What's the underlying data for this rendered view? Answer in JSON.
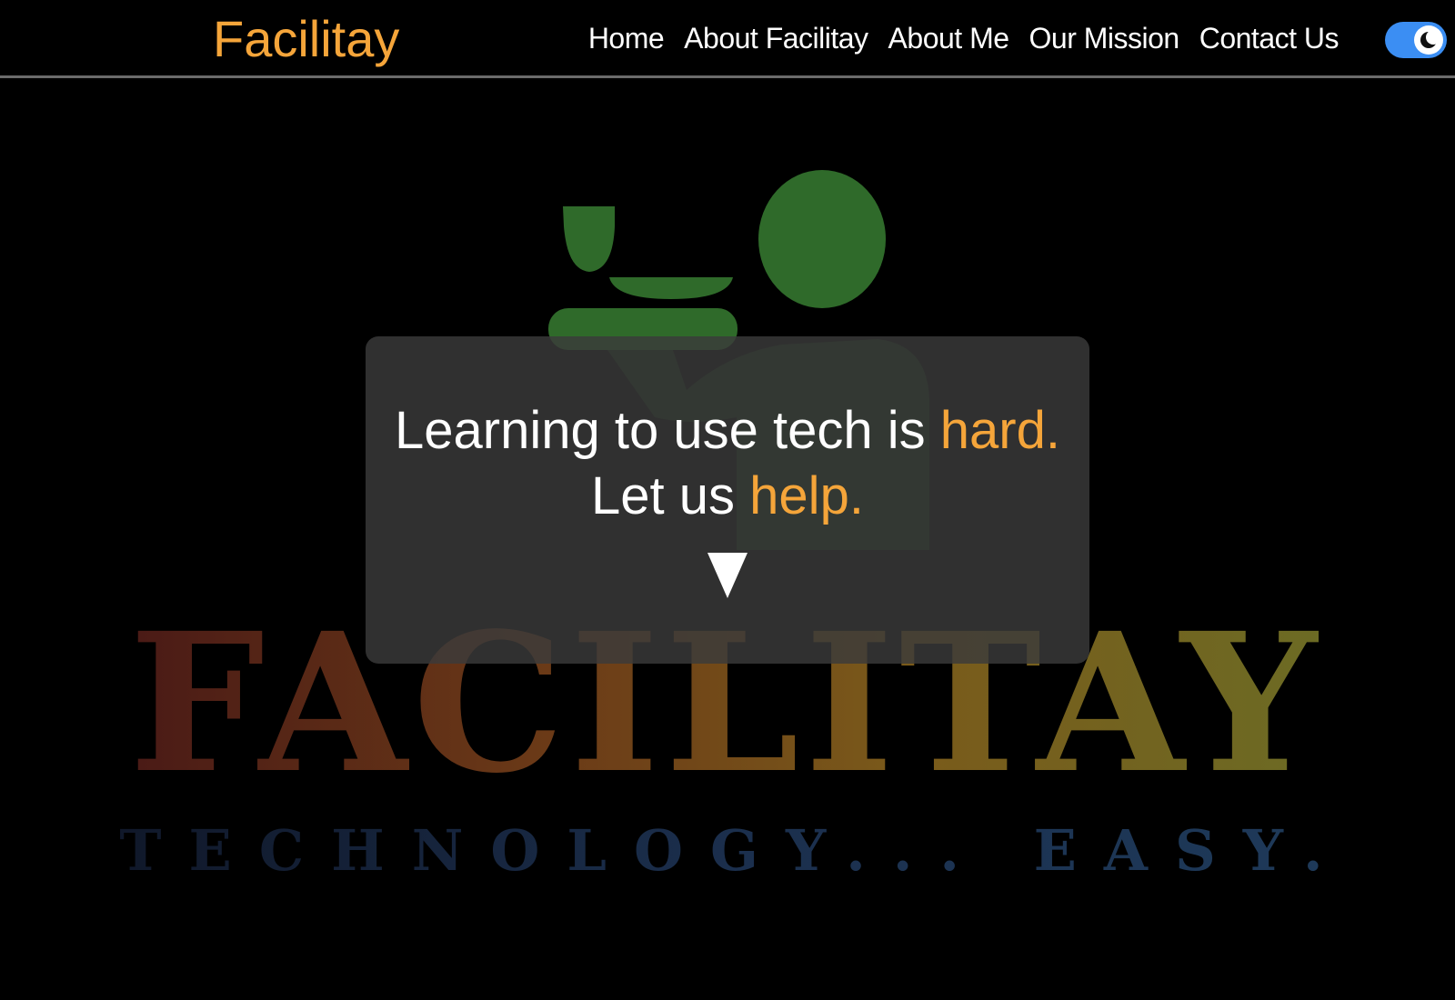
{
  "navbar": {
    "brand": "Facilitay",
    "links": [
      {
        "label": "Home"
      },
      {
        "label": "About Facilitay"
      },
      {
        "label": "About Me"
      },
      {
        "label": "Our Mission"
      },
      {
        "label": "Contact Us"
      }
    ],
    "theme_toggle": {
      "icon": "moon-icon",
      "state": "dark",
      "color": "#3b8ef3"
    }
  },
  "hero": {
    "logo": {
      "wordmark": "FACILITAY",
      "tagline": "TECHNOLOGY... EASY.",
      "icon": "waiter-with-tray-icon"
    },
    "headline": {
      "line1_prefix": "Learning to use tech is ",
      "line1_accent": "hard.",
      "line2_prefix": "Let us ",
      "line2_accent": "help."
    },
    "scroll_icon": "down-triangle-icon"
  },
  "colors": {
    "accent": "#f5a53a",
    "background": "#000000",
    "card": "#3a3a3a",
    "logo_green": "#2f6a2a",
    "tagline_blue": "#1b2f4d"
  }
}
